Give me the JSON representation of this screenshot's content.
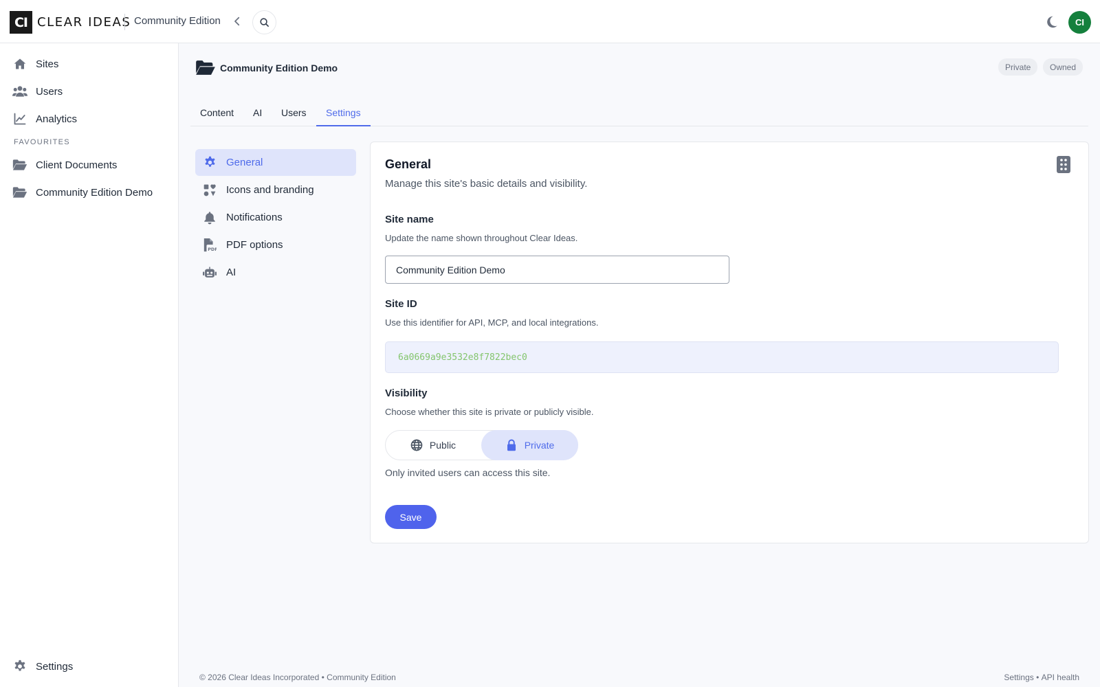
{
  "app": {
    "logo_mark": "CI",
    "logo_text": "CLEAR IDEAS",
    "edition": "Community Edition",
    "avatar_initials": "CI",
    "colors": {
      "accent": "#4f6bea",
      "avatar": "#15803d",
      "site_id": "#84c56d"
    }
  },
  "sidebar": {
    "items": [
      {
        "label": "Sites",
        "icon": "home-icon"
      },
      {
        "label": "Users",
        "icon": "users-icon"
      },
      {
        "label": "Analytics",
        "icon": "chart-line-icon"
      }
    ],
    "favourites_heading": "FAVOURITES",
    "favourites": [
      {
        "label": "Client Documents",
        "icon": "folder-open-icon"
      },
      {
        "label": "Community Edition Demo",
        "icon": "folder-open-icon"
      }
    ],
    "settings_label": "Settings"
  },
  "site": {
    "title": "Community Edition Demo",
    "badges": [
      "Private",
      "Owned"
    ]
  },
  "tabs": [
    {
      "label": "Content"
    },
    {
      "label": "AI"
    },
    {
      "label": "Users"
    },
    {
      "label": "Settings",
      "active": true
    }
  ],
  "settings_nav": [
    {
      "label": "General",
      "icon": "gear-icon",
      "active": true
    },
    {
      "label": "Icons and branding",
      "icon": "icons-icon"
    },
    {
      "label": "Notifications",
      "icon": "bell-icon"
    },
    {
      "label": "PDF options",
      "icon": "file-pdf-icon"
    },
    {
      "label": "AI",
      "icon": "robot-icon"
    }
  ],
  "general": {
    "title": "General",
    "subtitle": "Manage this site's basic details and visibility.",
    "site_name": {
      "label": "Site name",
      "help": "Update the name shown throughout Clear Ideas.",
      "value": "Community Edition Demo"
    },
    "site_id": {
      "label": "Site ID",
      "help": "Use this identifier for API, MCP, and local integrations.",
      "value": "6a0669a9e3532e8f7822bec0"
    },
    "visibility": {
      "label": "Visibility",
      "help": "Choose whether this site is private or publicly visible.",
      "options": [
        {
          "label": "Public",
          "icon": "globe-icon"
        },
        {
          "label": "Private",
          "icon": "lock-icon",
          "selected": true
        }
      ],
      "note": "Only invited users can access this site."
    },
    "save_label": "Save"
  },
  "footer": {
    "left": "© 2026 Clear Ideas Incorporated • Community Edition",
    "links": [
      "Settings",
      "API health"
    ],
    "separator": " • "
  }
}
